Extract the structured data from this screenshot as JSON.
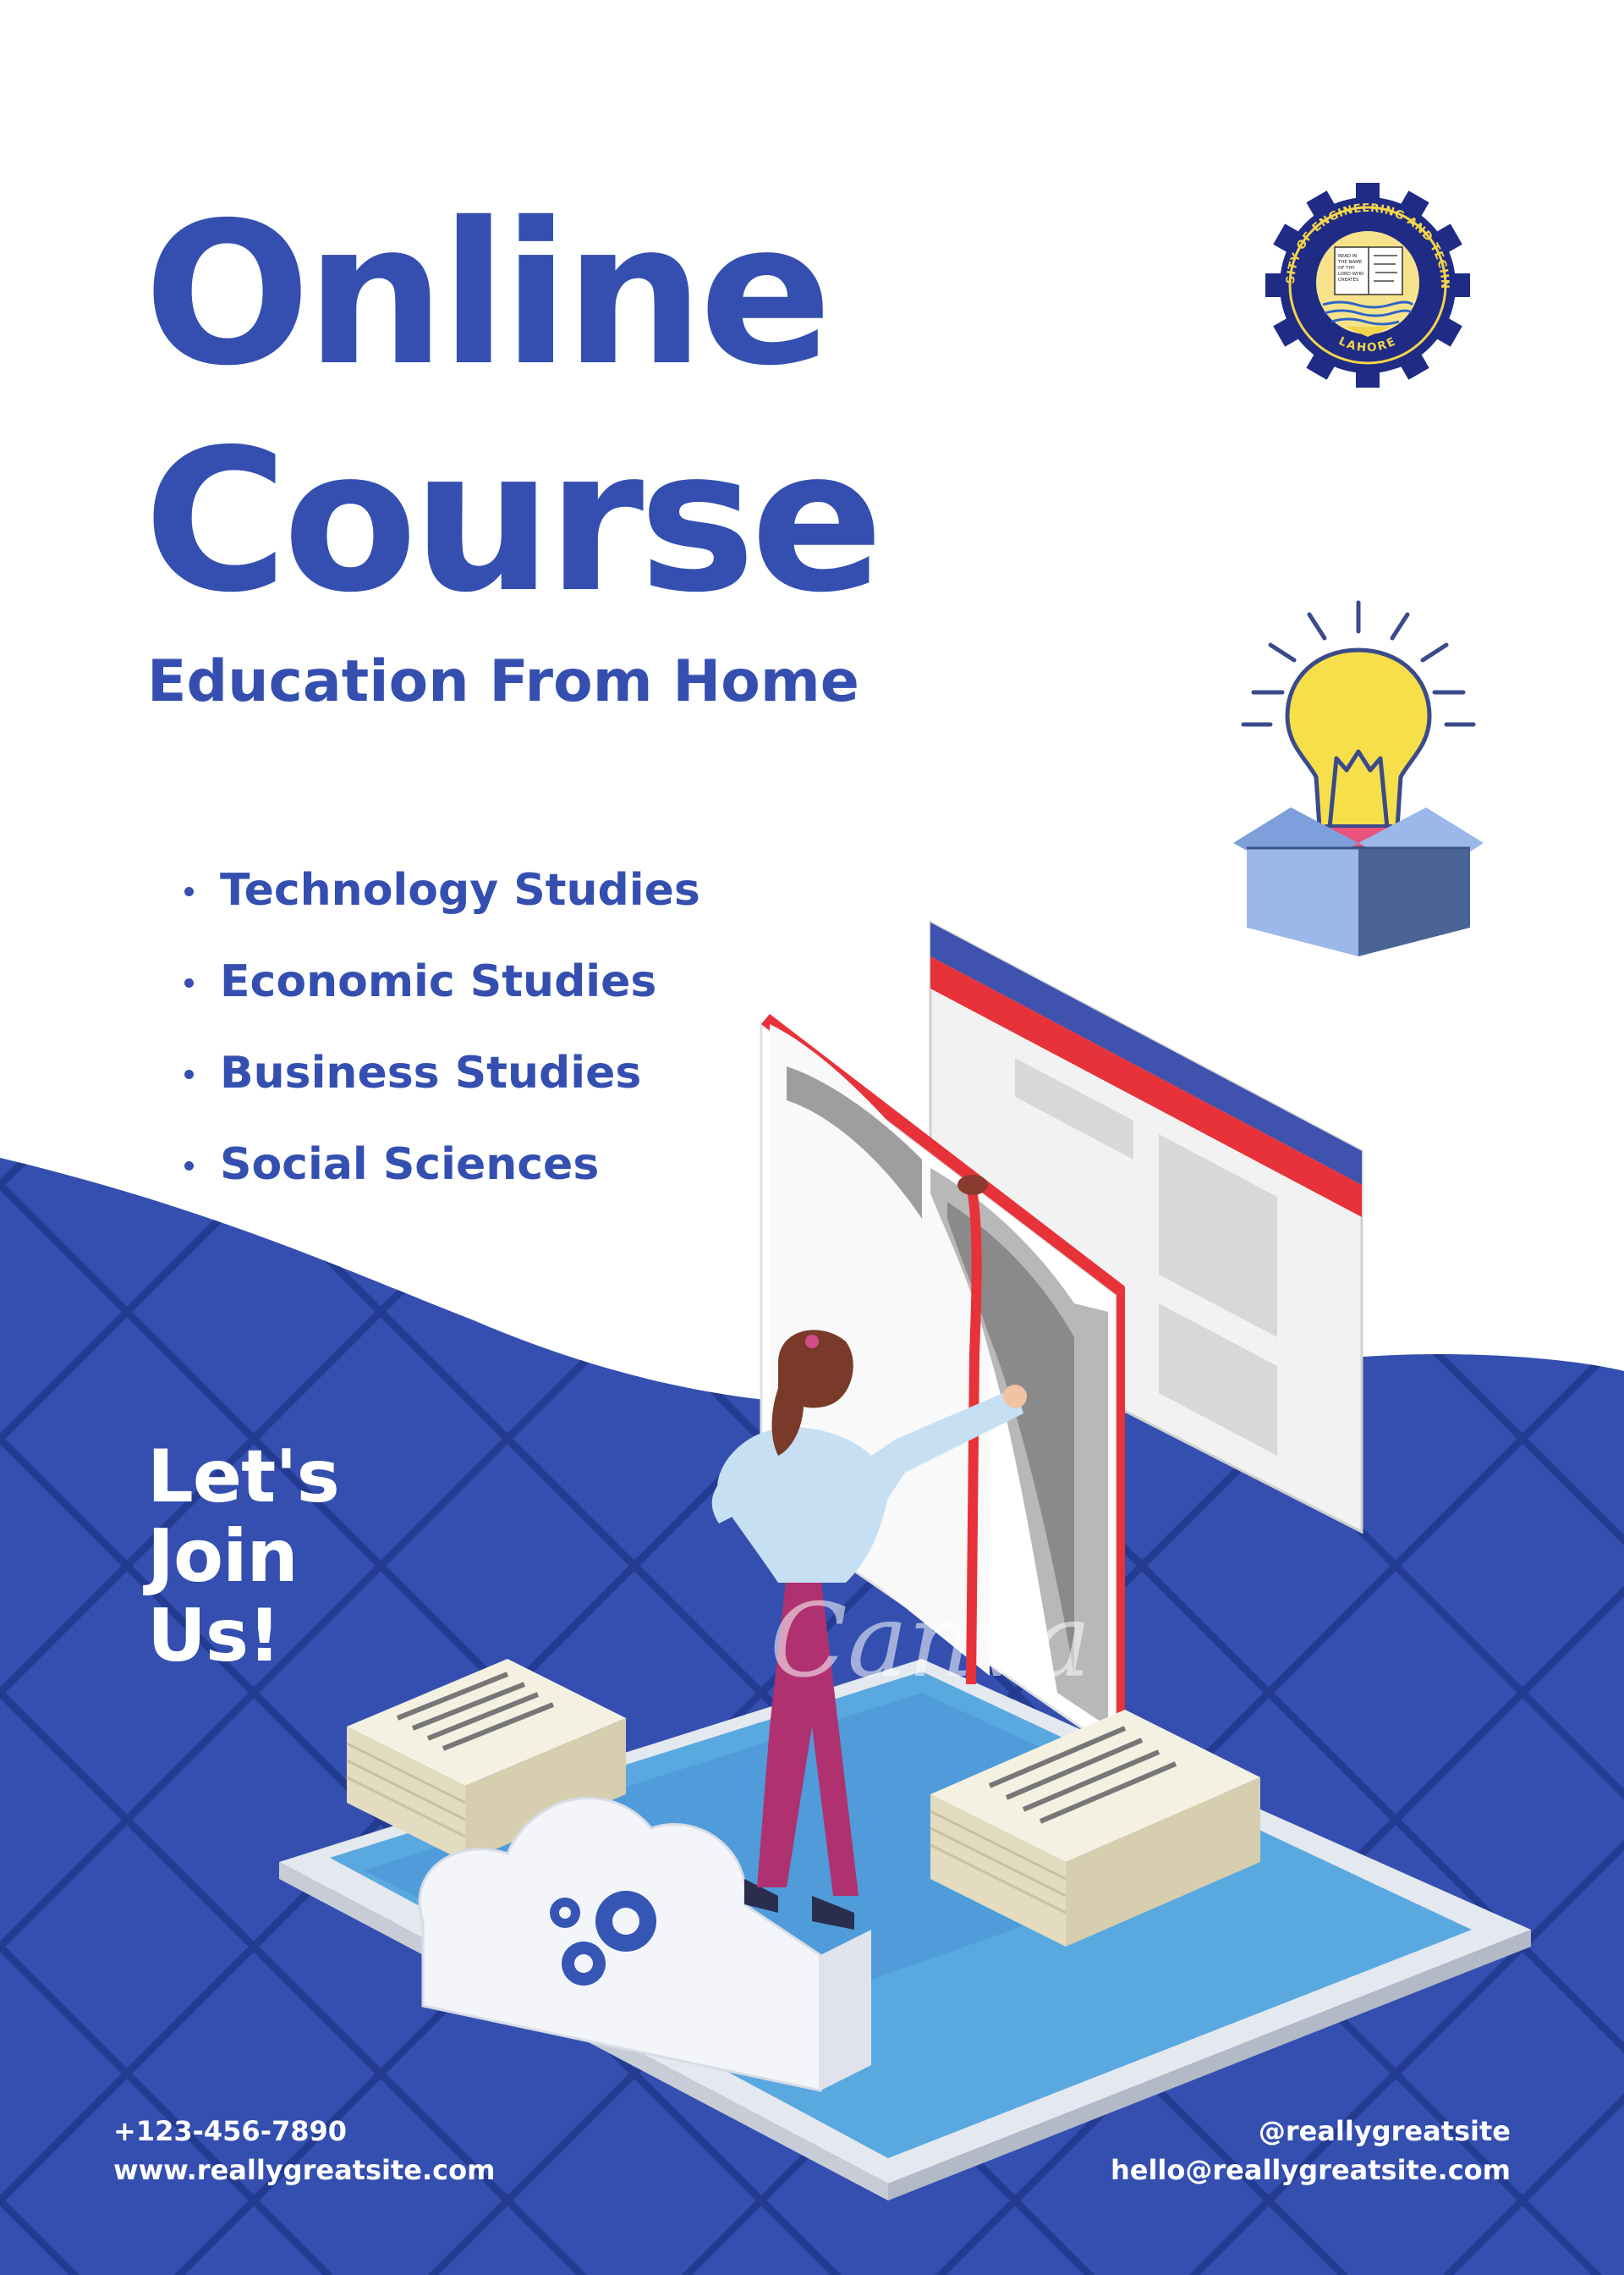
{
  "poster": {
    "title_line_1": "Online",
    "title_line_2": "Course",
    "subtitle": "Education From Home",
    "courses": [
      "Technology Studies",
      "Economic Studies",
      "Business Studies",
      "Social Sciences"
    ],
    "cta_line_1": "Let's",
    "cta_line_2": "Join",
    "cta_line_3": "Us!"
  },
  "contact": {
    "phone": "+123-456-7890",
    "website": "www.reallygreatsite.com",
    "social": "@reallygreatsite",
    "email": "hello@reallygreatsite.com"
  },
  "logo": {
    "ring_text_top": "UNIVERSITY OF ENGINEERING AND TECHNOLOGY",
    "ring_text_bottom": "LAHORE",
    "book_text_left": "READ IN THE NAME OF THY LORD WHO CREATES"
  },
  "watermark": "Canva",
  "icons": {
    "logo": "university-logo-icon",
    "idea": "lightbulb-in-box-icon",
    "illustration": "online-study-illustration"
  },
  "colors": {
    "primary_blue": "#344fb0",
    "background": "#ffffff",
    "text_on_blue": "#ffffff",
    "bulb_yellow": "#f7df4a",
    "box_blue": "#7f9fdc",
    "accent_red": "#e8323a"
  }
}
